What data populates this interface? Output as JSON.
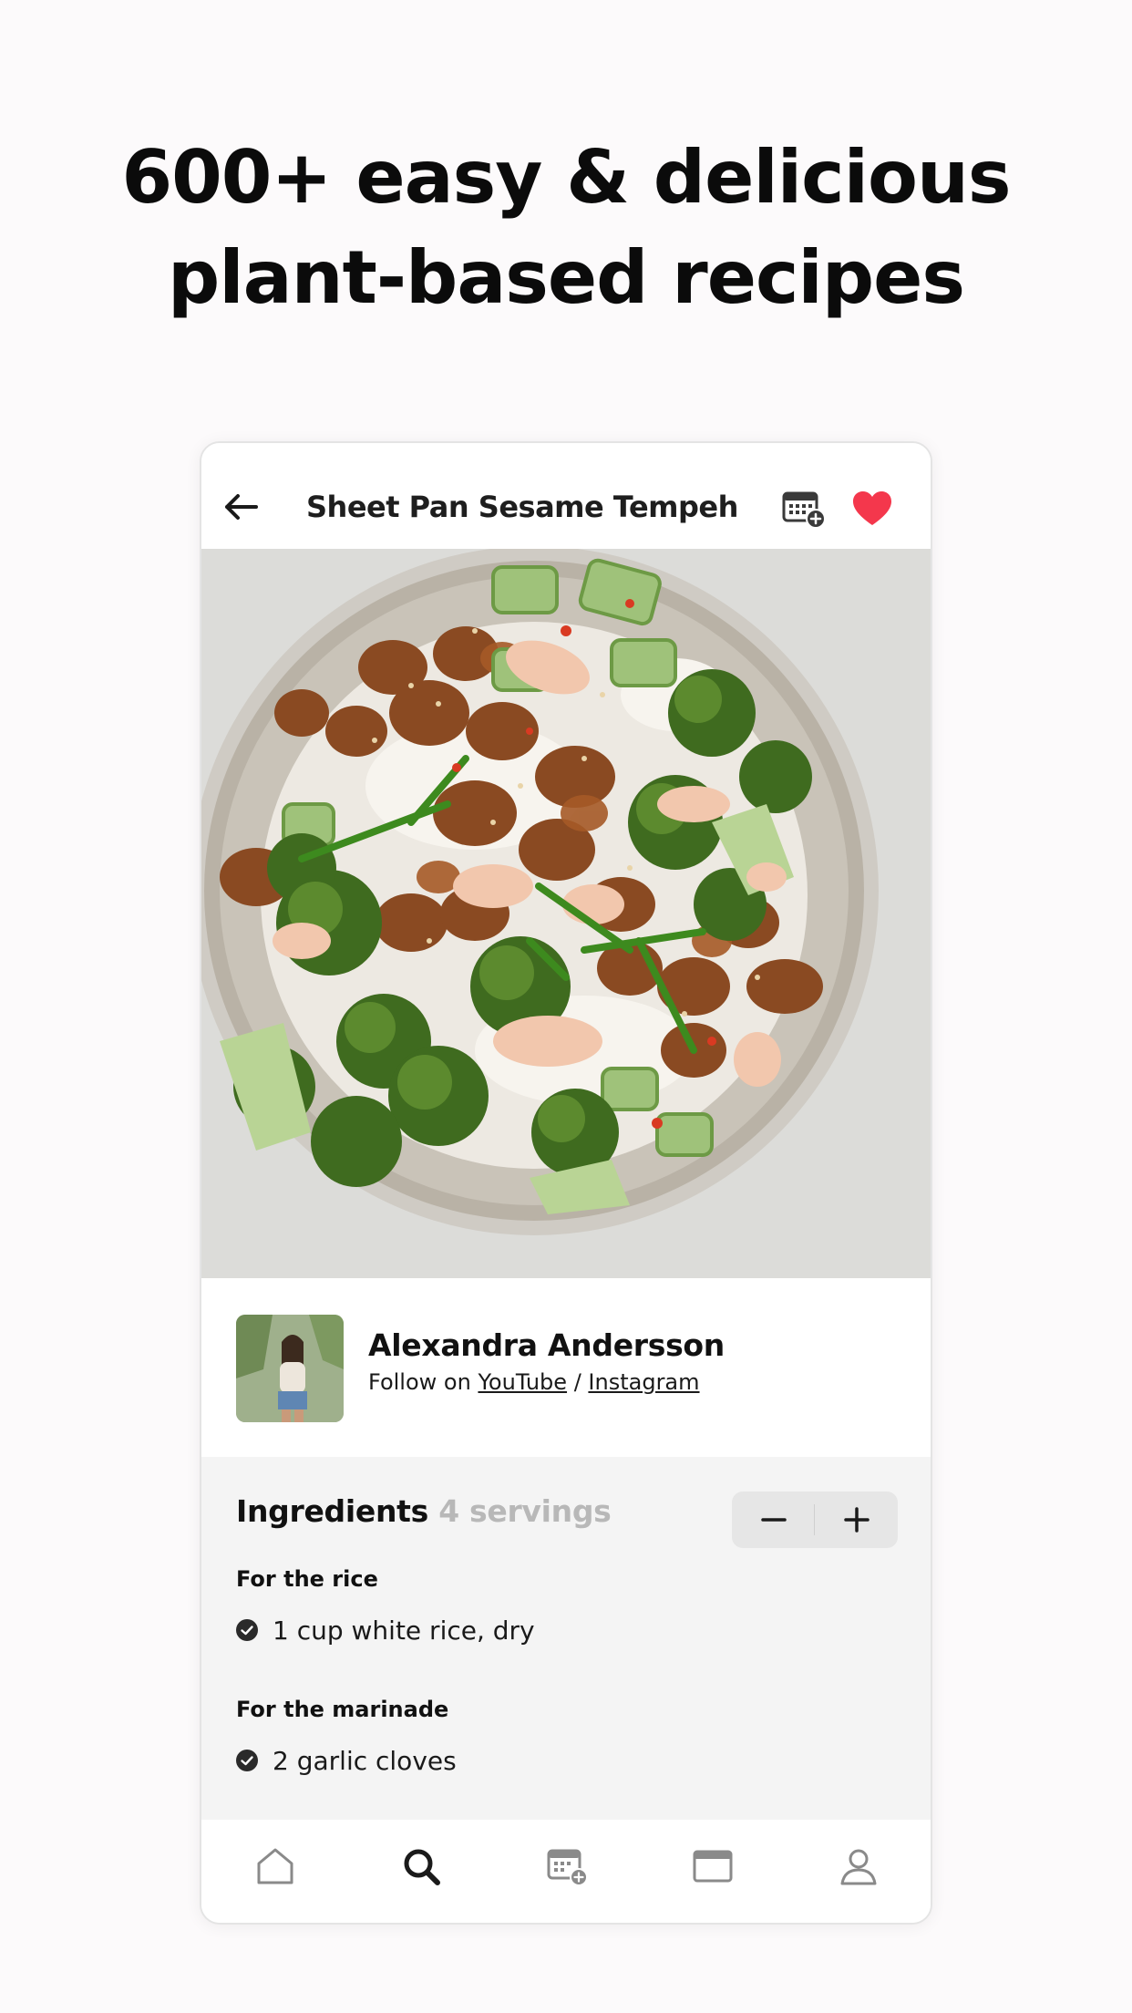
{
  "promo": {
    "headline_line1": "600+ easy & delicious",
    "headline_line2": "plant-based recipes"
  },
  "header": {
    "title": "Sheet Pan Sesame Tempeh",
    "back_icon": "arrow-left-icon",
    "calendar_icon": "calendar-add-icon",
    "favorite_icon": "heart-icon",
    "favorite_active": true
  },
  "author": {
    "name": "Alexandra Andersson",
    "follow_prefix": "Follow on",
    "youtube": "YouTube",
    "separator": "/",
    "instagram": "Instagram"
  },
  "ingredients": {
    "title": "Ingredients",
    "servings": "4 servings",
    "sections": [
      {
        "title": "For the rice",
        "items": [
          "1 cup white rice, dry"
        ]
      },
      {
        "title": "For the marinade",
        "items": [
          "2 garlic cloves"
        ]
      }
    ]
  },
  "nav": {
    "items": [
      "home-icon",
      "search-icon",
      "calendar-add-icon",
      "browser-icon",
      "profile-icon"
    ],
    "active": "search-icon"
  },
  "colors": {
    "accent_heart": "#f4374c",
    "page_bg": "#fcfafb",
    "ingredients_bg": "#f4f4f4",
    "stepper_bg": "#e6e6e6"
  }
}
